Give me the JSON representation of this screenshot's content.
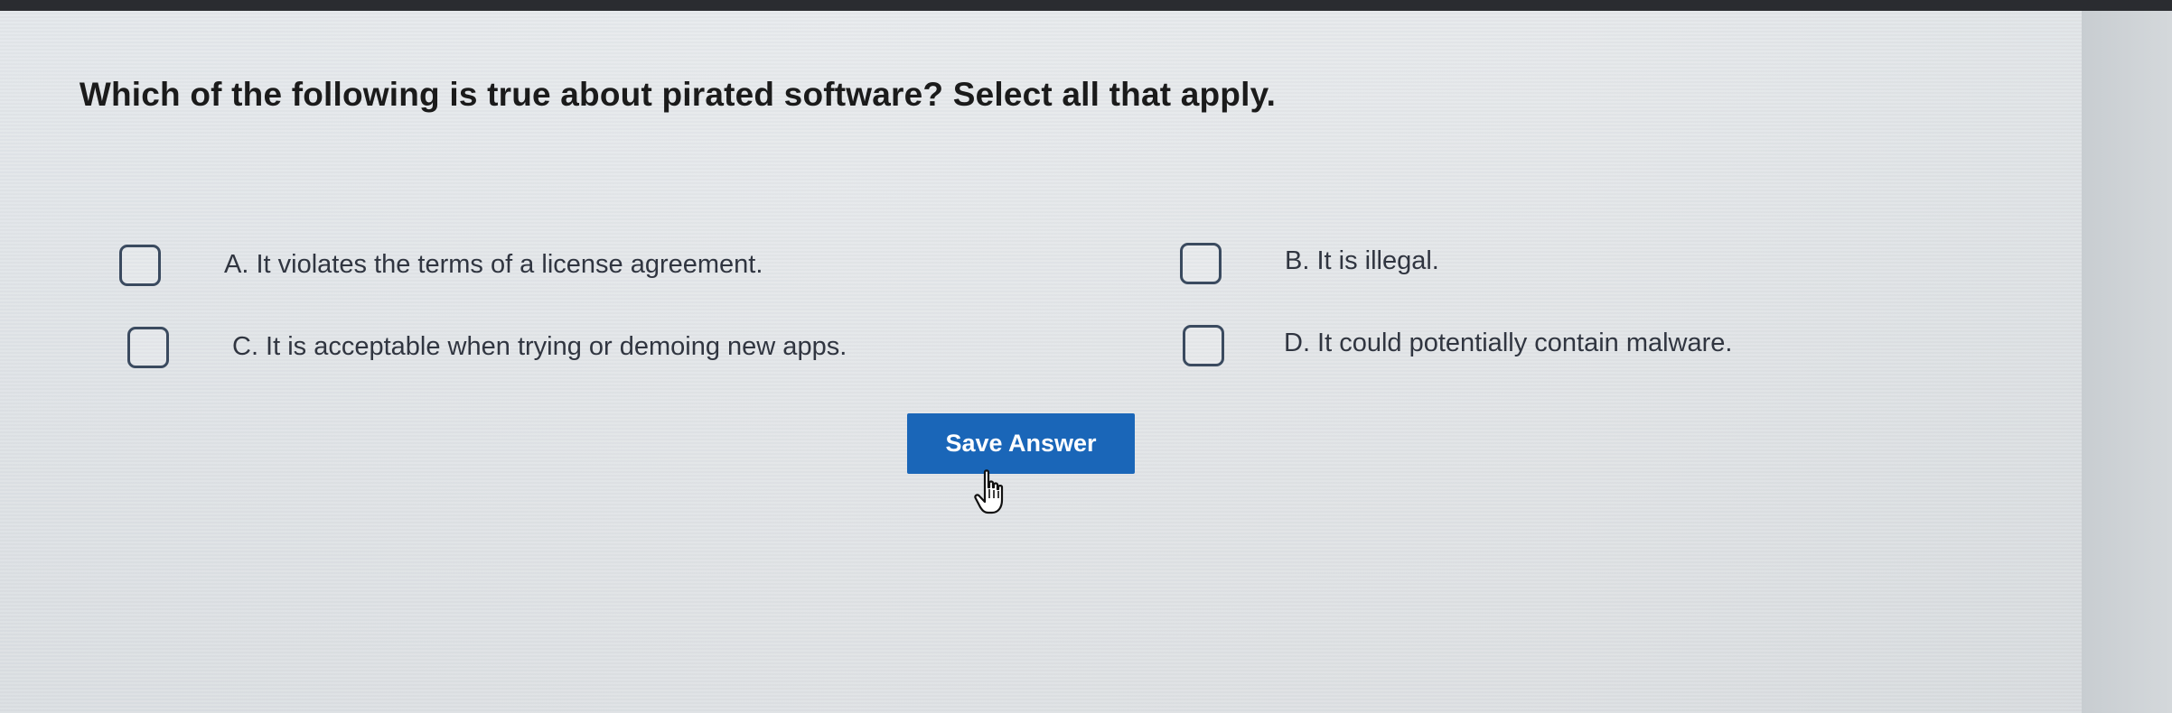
{
  "question": {
    "text": "Which of the following is true about pirated software? Select all that apply."
  },
  "options": [
    {
      "label": "A. It violates the terms of a license agreement.",
      "checked": false
    },
    {
      "label": "B. It is illegal.",
      "checked": false
    },
    {
      "label": "C. It is acceptable when trying or demoing new apps.",
      "checked": false
    },
    {
      "label": "D. It could potentially contain malware.",
      "checked": false
    }
  ],
  "actions": {
    "save_label": "Save Answer"
  },
  "cursor": {
    "icon": "hand-pointer-icon"
  },
  "colors": {
    "button": "#1a66b8",
    "checkbox_border": "#3a4a5f"
  }
}
